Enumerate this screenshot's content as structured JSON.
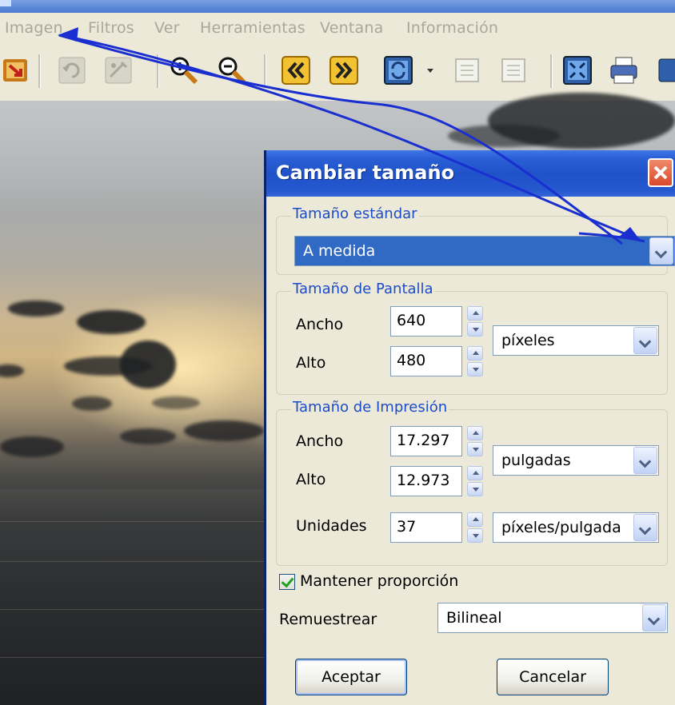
{
  "menubar": {
    "items": [
      "Imagen",
      "Filtros",
      "Ver",
      "Herramientas",
      "Ventana",
      "Información"
    ]
  },
  "toolbar": {
    "icons": [
      "import-icon",
      "undo-icon",
      "redo-icon",
      "zoom-in-icon",
      "zoom-out-icon",
      "previous-icon",
      "next-icon",
      "refresh-icon",
      "dropdown-icon",
      "page-left-icon",
      "page-right-icon",
      "fullscreen-icon",
      "print-icon"
    ]
  },
  "dialog": {
    "title": "Cambiar tamaño",
    "standard": {
      "label": "Tamaño estándar",
      "value": "A medida"
    },
    "screen": {
      "label": "Tamaño de Pantalla",
      "width_label": "Ancho",
      "width_value": "640",
      "height_label": "Alto",
      "height_value": "480",
      "unit": "píxeles"
    },
    "print": {
      "label": "Tamaño de Impresión",
      "width_label": "Ancho",
      "width_value": "17.297",
      "height_label": "Alto",
      "height_value": "12.973",
      "unit": "pulgadas",
      "units_label": "Unidades",
      "units_value": "37",
      "units_unit": "píxeles/pulgada"
    },
    "keep_ratio_label": "Mantener proporción",
    "keep_ratio_checked": true,
    "resample_label": "Remuestrear",
    "resample_value": "Bilineal",
    "ok_label": "Aceptar",
    "cancel_label": "Cancelar"
  },
  "colors": {
    "dialog_bg": "#ece9d8",
    "title_blue": "#2a5fd6",
    "selection": "#316ac5",
    "annotation_arrow": "#1a2fd0"
  }
}
